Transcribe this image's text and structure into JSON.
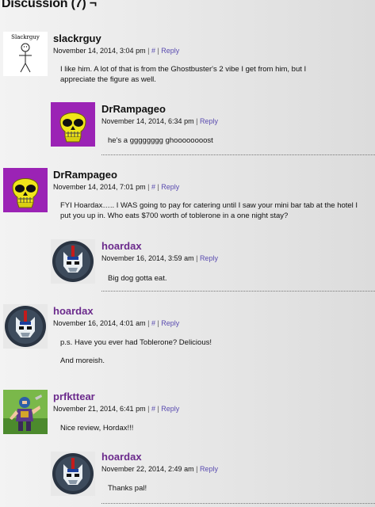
{
  "section": {
    "title": "Discussion (7) ¬"
  },
  "colors": {
    "link": "#5a4cb0",
    "author_purple": "#6b2a8c"
  },
  "comments": [
    {
      "author": "slackrguy",
      "date": "November 14, 2014, 3:04 pm",
      "permalink": "#",
      "reply": "Reply",
      "avatar_icon": "stick-figure-avatar",
      "avatar_text": "Slackrguy",
      "paragraphs": [
        "I like him. A lot of that is from the Ghostbuster's 2 vibe I get from him, but I appreciate the figure as well."
      ]
    },
    {
      "author": "DrRampageo",
      "date": "November 14, 2014, 6:34 pm",
      "reply": "Reply",
      "avatar_icon": "yellow-skull-avatar",
      "paragraphs": [
        "he's a gggggggg ghoooooooost"
      ]
    },
    {
      "author": "DrRampageo",
      "date": "November 14, 2014, 7:01 pm",
      "permalink": "#",
      "reply": "Reply",
      "avatar_icon": "yellow-skull-avatar",
      "paragraphs": [
        "FYI Hoardax….. I WAS going to pay for catering until I saw your mini bar tab at the hotel I put you up in. Who eats $700 worth of toblerone in a one night stay?"
      ]
    },
    {
      "author": "hoardax",
      "date": "November 16, 2014, 3:59 am",
      "reply": "Reply",
      "avatar_icon": "robot-helmet-avatar",
      "paragraphs": [
        "Big dog gotta eat."
      ]
    },
    {
      "author": "hoardax",
      "date": "November 16, 2014, 4:01 am",
      "permalink": "#",
      "reply": "Reply",
      "avatar_icon": "robot-helmet-avatar",
      "paragraphs": [
        "p.s. Have you ever had Toblerone? Delicious!",
        "And moreish."
      ]
    },
    {
      "author": "prfkttear",
      "date": "November 21, 2014, 6:41 pm",
      "permalink": "#",
      "reply": "Reply",
      "avatar_icon": "action-figure-avatar",
      "paragraphs": [
        "Nice review, Hordax!!!"
      ]
    },
    {
      "author": "hoardax",
      "date": "November 22, 2014, 2:49 am",
      "reply": "Reply",
      "avatar_icon": "robot-helmet-avatar",
      "paragraphs": [
        "Thanks pal!"
      ]
    }
  ]
}
